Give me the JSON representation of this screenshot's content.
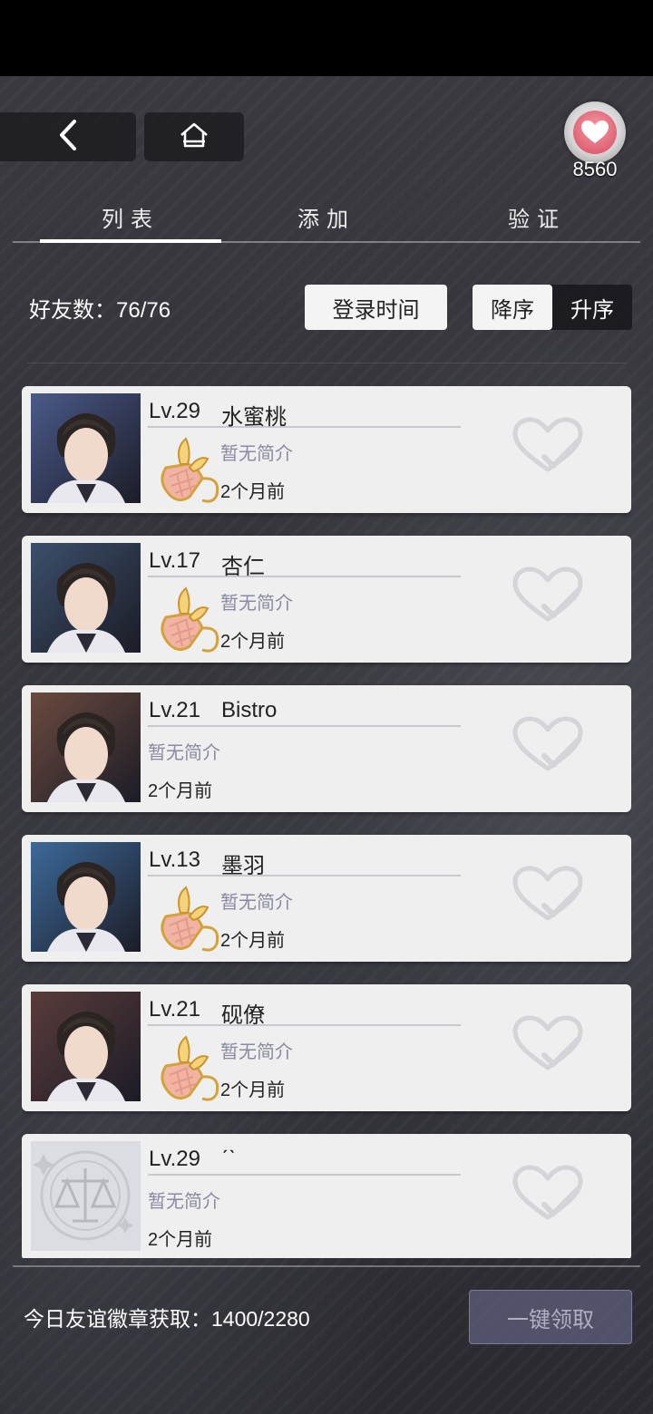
{
  "header": {
    "currency_count": "8560"
  },
  "tabs": [
    {
      "label": "列表"
    },
    {
      "label": "添加"
    },
    {
      "label": "验证"
    }
  ],
  "toolbar": {
    "friend_count": "好友数：76/76",
    "sort_field": "登录时间",
    "order_desc": "降序",
    "order_asc": "升序"
  },
  "friends": [
    {
      "level": "Lv.29",
      "name": "水蜜桃",
      "bio": "暂无简介",
      "time": "2个月前",
      "has_badge": true,
      "avatar_tone": "#4a5a8a"
    },
    {
      "level": "Lv.17",
      "name": "杏仁",
      "bio": "暂无简介",
      "time": "2个月前",
      "has_badge": true,
      "avatar_tone": "#3b4f6b"
    },
    {
      "level": "Lv.21",
      "name": "Bistro",
      "bio": "暂无简介",
      "time": "2个月前",
      "has_badge": false,
      "avatar_tone": "#6b4a3f"
    },
    {
      "level": "Lv.13",
      "name": "墨羽",
      "bio": "暂无简介",
      "time": "2个月前",
      "has_badge": true,
      "avatar_tone": "#3c6a9a"
    },
    {
      "level": "Lv.21",
      "name": "砚僚",
      "bio": "暂无简介",
      "time": "2个月前",
      "has_badge": true,
      "avatar_tone": "#5a3c3c"
    },
    {
      "level": "Lv.29",
      "name": "ˊˋ",
      "bio": "暂无简介",
      "time": "2个月前",
      "has_badge": false,
      "avatar_tone": "#dcdde2"
    }
  ],
  "footer": {
    "daily_badges": "今日友谊徽章获取：1400/2280",
    "claim_all": "一键领取"
  }
}
